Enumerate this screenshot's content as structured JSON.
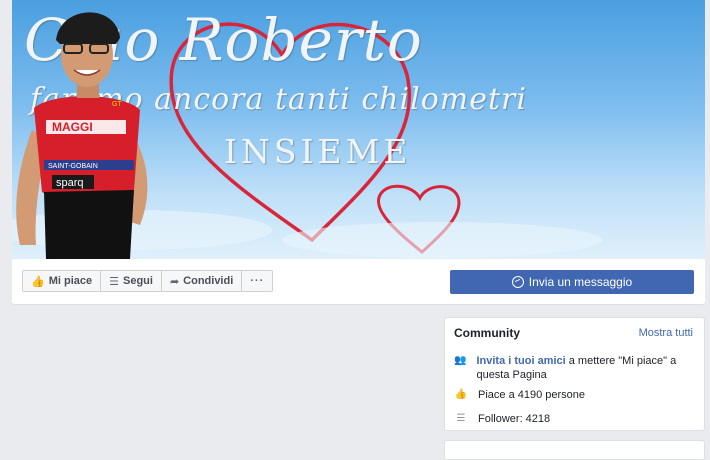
{
  "cover": {
    "title": "Ciao Roberto",
    "subtitle": "faremo ancora tanti chilometri",
    "insieme": "INSIEME",
    "jersey_text": [
      "MAGGI",
      "SAINT-GOBAIN",
      "sparq",
      "GT"
    ]
  },
  "actions": {
    "like": "Mi piace",
    "follow": "Segui",
    "share": "Condividi",
    "more": "···",
    "message": "Invia un messaggio"
  },
  "community": {
    "title": "Community",
    "see_all": "Mostra tutti",
    "invite_link": "Invita i tuoi amici",
    "invite_rest": " a mettere \"Mi piace\" a questa Pagina",
    "likes": "Piace a 4190 persone",
    "followers": "Follower: 4218"
  },
  "colors": {
    "accent": "#4267b2",
    "heart": "#d9253a",
    "jersey_red": "#d71e2b"
  }
}
